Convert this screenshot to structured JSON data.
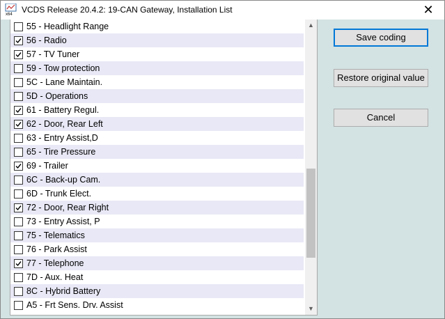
{
  "window": {
    "title": "VCDS Release 20.4.2: 19-CAN Gateway,  Installation List",
    "icon": "vcds-app-icon",
    "icon_badge": "x64",
    "close_glyph": "✕"
  },
  "list": {
    "items": [
      {
        "label": "55 - Headlight Range",
        "checked": false
      },
      {
        "label": "56 - Radio",
        "checked": true
      },
      {
        "label": "57 - TV Tuner",
        "checked": true
      },
      {
        "label": "59 - Tow protection",
        "checked": false
      },
      {
        "label": "5C - Lane Maintain.",
        "checked": false
      },
      {
        "label": "5D - Operations",
        "checked": false
      },
      {
        "label": "61 - Battery Regul.",
        "checked": true
      },
      {
        "label": "62 - Door, Rear Left",
        "checked": true
      },
      {
        "label": "63 - Entry Assist,D",
        "checked": false
      },
      {
        "label": "65 - Tire Pressure",
        "checked": false
      },
      {
        "label": "69 - Trailer",
        "checked": true
      },
      {
        "label": "6C - Back-up Cam.",
        "checked": false
      },
      {
        "label": "6D - Trunk Elect.",
        "checked": false
      },
      {
        "label": "72 - Door, Rear Right",
        "checked": true
      },
      {
        "label": "73 - Entry Assist, P",
        "checked": false
      },
      {
        "label": "75 - Telematics",
        "checked": false
      },
      {
        "label": "76 - Park Assist",
        "checked": false
      },
      {
        "label": "77 - Telephone",
        "checked": true
      },
      {
        "label": "7D - Aux. Heat",
        "checked": false
      },
      {
        "label": "8C - Hybrid Battery",
        "checked": false
      },
      {
        "label": "A5 - Frt Sens. Drv. Assist",
        "checked": false
      }
    ],
    "scroll_position": 0.75
  },
  "buttons": {
    "save": "Save coding",
    "restore": "Restore original value",
    "cancel": "Cancel"
  },
  "colors": {
    "panel_bg": "#d3e2e2",
    "row_alt": "#e8e8f6",
    "focus_border": "#0078d7"
  }
}
